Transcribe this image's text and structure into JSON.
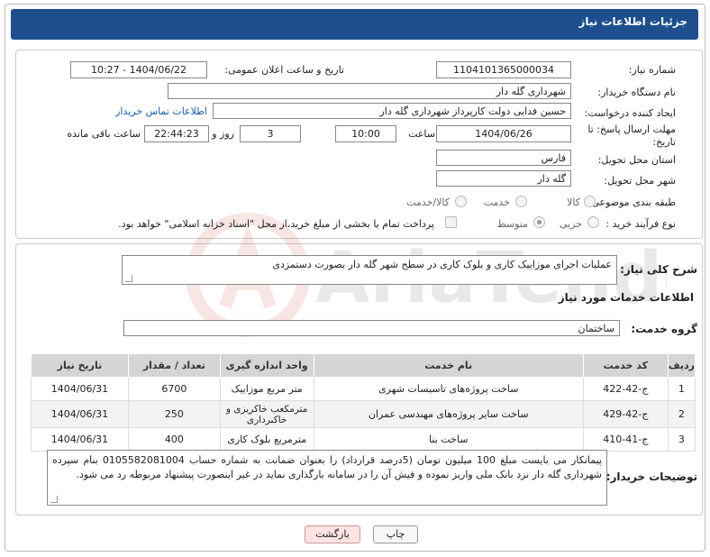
{
  "header": {
    "title": "جزئیات اطلاعات نیاز"
  },
  "form": {
    "need_number_label": "شماره نیاز:",
    "need_number": "1104101365000034",
    "announce_label": "تاریخ و ساعت اعلان عمومی:",
    "announce_value": "1404/06/22 - 10:27",
    "buyer_org_label": "نام دستگاه خریدار:",
    "buyer_org": "شهرداری گله دار",
    "creator_label": "ایجاد کننده درخواست:",
    "creator": "حسین فدایی دولت کارپرداز شهرداری گله دار",
    "contact_link": "اطلاعات تماس خریدار",
    "deadline_label_1": "مهلت ارسال پاسخ: تا",
    "deadline_label_2": "تاریخ:",
    "deadline_date": "1404/06/26",
    "time_label": "ساعت",
    "deadline_time": "10:00",
    "days_value": "3",
    "days_label": "روز و",
    "remaining_time": "22:44:23",
    "remaining_label": "ساعت باقی مانده",
    "province_label": "استان محل تحویل:",
    "province": "فارس",
    "city_label": "شهر محل تحویل:",
    "city": "گله دار",
    "category_label": "طبقه بندی موضوعی:",
    "cat_goods": "کالا",
    "cat_service": "خدمت",
    "cat_goods_service": "کالا/خدمت",
    "process_label": "نوع فرآیند خرید :",
    "proc_partial": "جزیی",
    "proc_medium": "متوسط",
    "payment_note": "پرداخت تمام یا بخشی از مبلغ خرید،از محل \"اسناد خزانه اسلامی\" خواهد بود."
  },
  "details": {
    "summary_label": "شرح کلی نیاز:",
    "summary": "عملیات اجرای موزاییک کاری و بلوک کاری در سطح شهر گله دار بصورت دستمزدی",
    "services_title": "اطلاعات خدمات مورد نیاز",
    "group_label": "گروه خدمت:",
    "group": "ساختمان",
    "table": {
      "headers": [
        "ردیف",
        "کد خدمت",
        "نام خدمت",
        "واحد اندازه گیری",
        "تعداد / مقدار",
        "تاریخ نیاز"
      ],
      "rows": [
        [
          "1",
          "ج-42-422",
          "ساخت پروژه‌های تاسیسات شهری",
          "متر مربع موزاییک",
          "6700",
          "1404/06/31"
        ],
        [
          "2",
          "ج-42-429",
          "ساخت سایر پروژه‌های مهندسی عمران",
          "مترمکعب خاکریزی و خاکبرداری",
          "250",
          "1404/06/31"
        ],
        [
          "3",
          "ج-41-410",
          "ساخت بنا",
          "مترمربع بلوک کاری",
          "400",
          "1404/06/31"
        ]
      ]
    },
    "notes_label": "توضیحات خریدار:",
    "notes": "پیمانکار می بایست مبلغ 100 میلیون تومان (5درصد قرارداد) را بعنوان ضمانت به شماره حساب  0105582081004 بنام سپرده شهرداری گله دار نزد بانک ملی  واریز نموده و فیش آن را در سامانه بارگذاری نماید در غیر اینصورت پیشنهاد مربوطه رد می شود."
  },
  "buttons": {
    "print": "چاپ",
    "back": "بازگشت"
  },
  "watermark": {
    "text": "AriaTender.neT"
  }
}
